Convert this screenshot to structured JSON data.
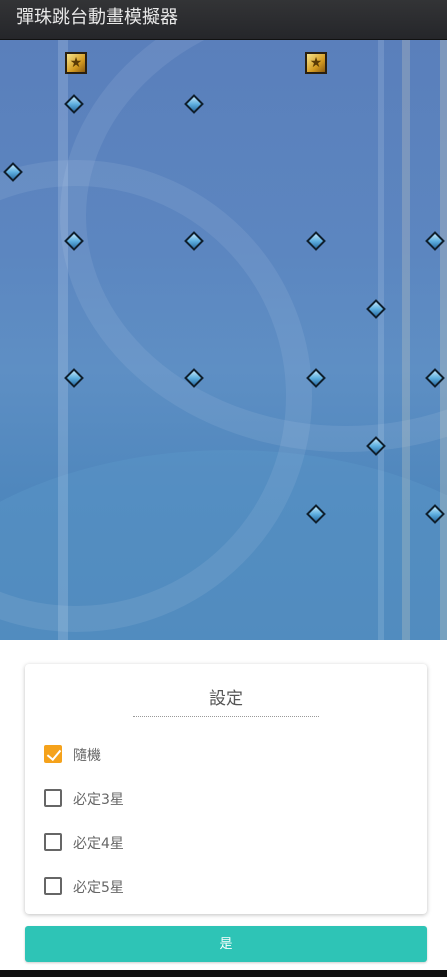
{
  "window": {
    "title": "彈珠跳台動畫模擬器"
  },
  "board": {
    "icons": {
      "peg": "diamond-peg-icon",
      "goal": "star-goal-icon"
    },
    "colors": {
      "sky": "#5c86c0",
      "peg": "#5fb0e0",
      "goal": "#d49b22"
    }
  },
  "settings": {
    "title": "設定",
    "options": [
      {
        "label": "隨機",
        "checked": true
      },
      {
        "label": "必定3星",
        "checked": false
      },
      {
        "label": "必定4星",
        "checked": false
      },
      {
        "label": "必定5星",
        "checked": false
      }
    ],
    "confirm_label": "是",
    "accent_color": "#f5a21b",
    "button_color": "#2ec4b6"
  }
}
